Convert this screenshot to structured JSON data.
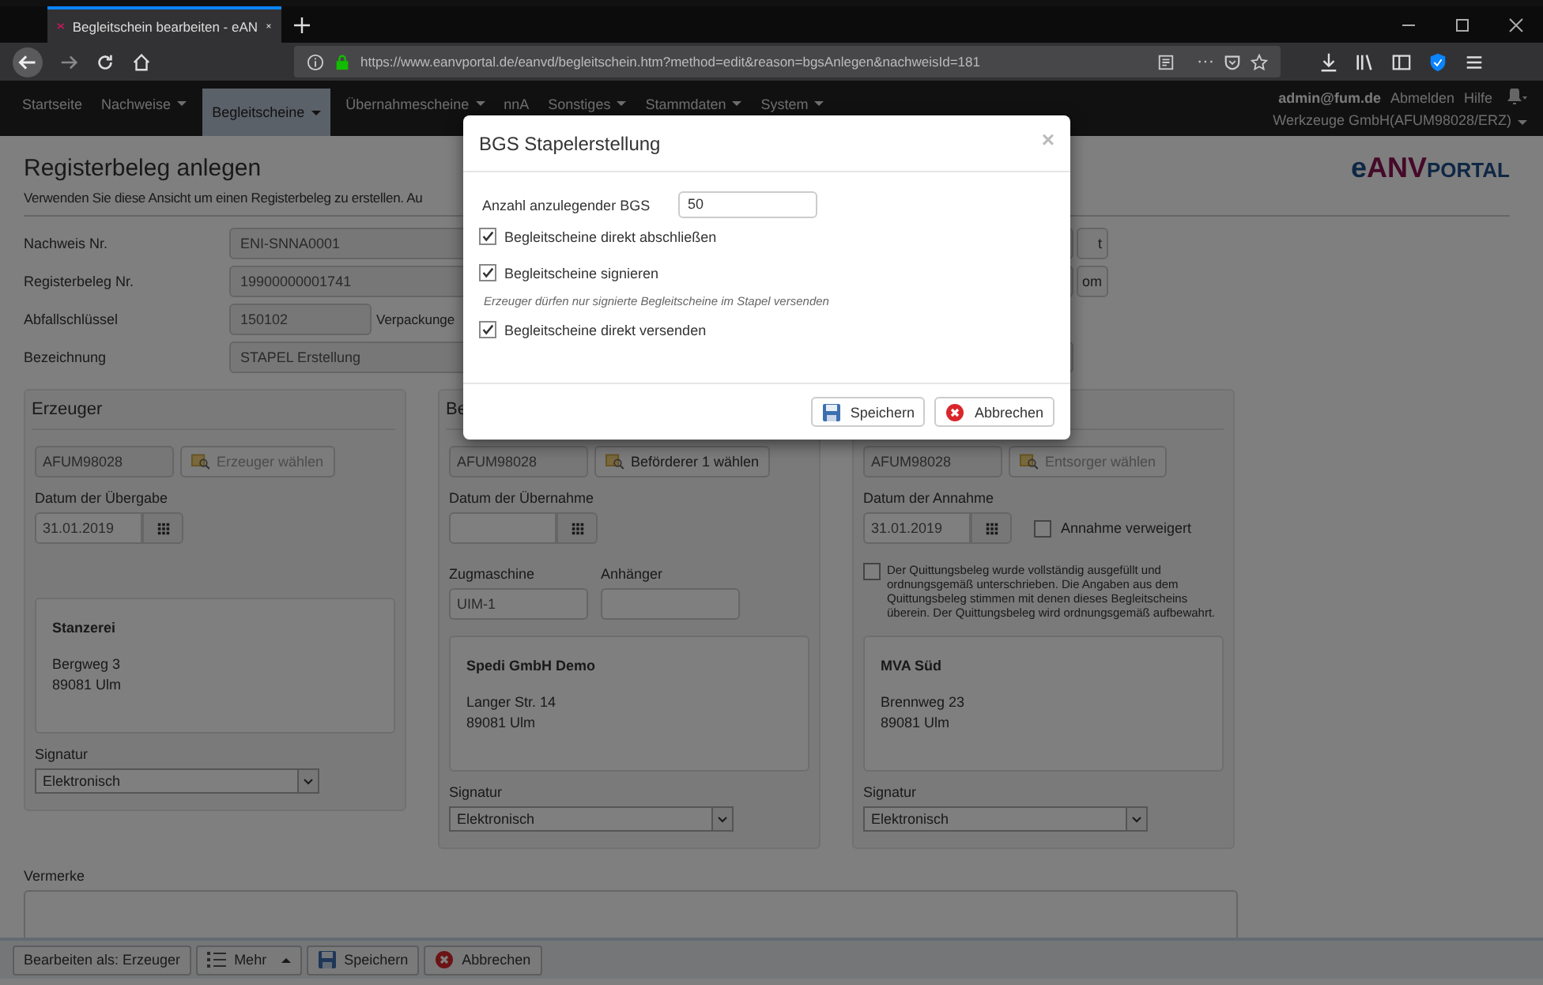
{
  "browser": {
    "tab_title": "Begleitschein bearbeiten - eAN",
    "url": "https://www.eanvportal.de/eanvd/begleitschein.htm?method=edit&reason=bgsAnlegen&nachweisId=181",
    "menu_dots": "···"
  },
  "nav": {
    "items": [
      {
        "label": "Startseite",
        "selected": false,
        "caret": false
      },
      {
        "label": "Nachweise",
        "selected": false,
        "caret": true
      },
      {
        "label": "Begleitscheine",
        "selected": true,
        "caret": true
      },
      {
        "label": "Übernahmescheine",
        "selected": false,
        "caret": true
      },
      {
        "label": "nnA",
        "selected": false,
        "caret": false
      },
      {
        "label": "Sonstiges",
        "selected": false,
        "caret": true
      },
      {
        "label": "Stammdaten",
        "selected": false,
        "caret": true
      },
      {
        "label": "System",
        "selected": false,
        "caret": true
      }
    ],
    "user": "admin@fum.de",
    "links": [
      "Abmelden",
      "Hilfe"
    ],
    "org": "Werkzeuge GmbH(AFUM98028/ERZ)"
  },
  "page": {
    "title": "Registerbeleg anlegen",
    "description": "Verwenden Sie diese Ansicht um einen Registerbeleg zu erstellen. Au",
    "logo": [
      "e",
      "ANV",
      "PORTAL"
    ],
    "fields": [
      {
        "label": "Nachweis Nr.",
        "value": "ENI-SNNA0001",
        "side_button": "t"
      },
      {
        "label": "Registerbeleg Nr.",
        "value": "19900000001741",
        "side_button": "om"
      },
      {
        "label": "Abfallschlüssel",
        "value": "150102",
        "note": "Verpackunge"
      },
      {
        "label": "Bezeichnung",
        "value": "STAPEL Erstellung"
      }
    ],
    "panels": [
      {
        "heading": "Erzeuger",
        "id_value": "AFUM98028",
        "choose": {
          "label": "Erzeuger wählen",
          "disabled": true
        },
        "date_label": "Datum der Übergabe",
        "date_value": "31.01.2019",
        "address": {
          "name": "Stanzerei",
          "lines": [
            "Bergweg 3",
            "89081 Ulm"
          ]
        },
        "signatur_label": "Signatur",
        "signatur": "Elektronisch"
      },
      {
        "heading": "Be",
        "id_value": "AFUM98028",
        "choose": {
          "label": "Beförderer 1 wählen",
          "disabled": false
        },
        "date_label": "Datum der Übernahme",
        "vehicle": [
          {
            "label": "Zugmaschine",
            "value": "UIM-1"
          },
          {
            "label": "Anhänger"
          }
        ],
        "address": {
          "name": "Spedi GmbH Demo",
          "lines": [
            "Langer Str. 14",
            "89081 Ulm"
          ]
        },
        "signatur_label": "Signatur",
        "signatur": "Elektronisch"
      },
      {
        "id_value": "AFUM98028",
        "choose": {
          "label": "Entsorger wählen",
          "disabled": true
        },
        "date_label": "Datum der Annahme",
        "date_value": "31.01.2019",
        "refused": {
          "label": "Annahme verweigert",
          "checked": false
        },
        "receipt": {
          "label": "Der Quittungsbeleg wurde vollständig ausgefüllt und ordnungsgemäß unterschrieben. Die Angaben aus dem Quittungsbeleg stimmen mit denen dieses Begleitscheins überein. Der Quittungsbeleg wird ordnungsgemäß aufbewahrt.",
          "checked": false
        },
        "address": {
          "name": "MVA Süd",
          "lines": [
            "Brennweg 23",
            "89081 Ulm"
          ]
        },
        "signatur_label": "Signatur",
        "signatur": "Elektronisch"
      }
    ],
    "remarks_label": "Vermerke"
  },
  "bottom_bar": [
    {
      "label": "Bearbeiten als: Erzeuger",
      "caret": false
    },
    {
      "label": "Mehr",
      "caret": true
    },
    {
      "label": "Speichern",
      "caret": false
    },
    {
      "label": "Abbrechen",
      "caret": false
    }
  ],
  "modal": {
    "title": "BGS Stapelerstellung",
    "close": "×",
    "count_label": "Anzahl anzulegender BGS",
    "count_value": "50",
    "options": [
      {
        "kind": "checkbox",
        "label": "Begleitscheine direkt abschließen",
        "checked": true
      },
      {
        "kind": "checkbox",
        "label": "Begleitscheine signieren",
        "checked": true
      },
      {
        "kind": "note",
        "label": "Erzeuger dürfen nur signierte Begleitscheine im Stapel versenden"
      },
      {
        "kind": "checkbox",
        "label": "Begleitscheine direkt versenden",
        "checked": true
      }
    ],
    "buttons": [
      {
        "label": "Speichern"
      },
      {
        "label": "Abbrechen"
      }
    ]
  }
}
